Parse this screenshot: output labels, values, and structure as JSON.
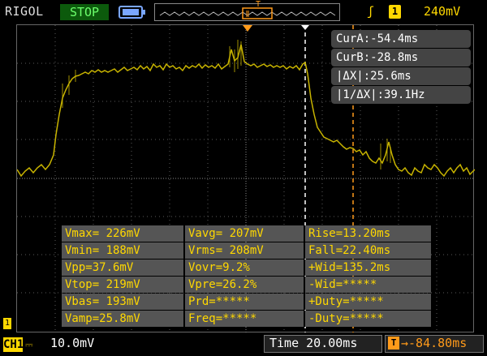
{
  "header": {
    "brand": "RIGOL",
    "run_state": "STOP",
    "trigger": {
      "edge_symbol": "ʃ",
      "source": "1",
      "level": "240mV"
    }
  },
  "cursors": {
    "cur_a": "CurA:-54.4ms",
    "cur_b": "CurB:-28.8ms",
    "delta_x": "|ΔX|:25.6ms",
    "inv_delta_x": "|1/ΔX|:39.1Hz"
  },
  "measurements": [
    [
      "Vmax= 226mV",
      "Vavg= 207mV",
      "Rise=13.20ms"
    ],
    [
      "Vmin= 188mV",
      "Vrms= 208mV",
      "Fall=22.40ms"
    ],
    [
      "Vpp=37.6mV",
      "Vovr=9.2%",
      "+Wid=135.2ms"
    ],
    [
      "Vtop= 219mV",
      "Vpre=26.2%",
      "-Wid=*****"
    ],
    [
      "Vbas= 193mV",
      "Prd=*****",
      "+Duty=*****"
    ],
    [
      "Vamp=25.8mV",
      "Freq=*****",
      "-Duty=*****"
    ]
  ],
  "channel": {
    "label": "CH1",
    "coupling_icon": "dc-coupling-icon",
    "scale": "10.0mV",
    "ground_marker": "1"
  },
  "timebase": "Time 20.00ms",
  "delay": {
    "icon": "T",
    "value": "→-84.80ms"
  },
  "colors": {
    "trace": "#c8b400",
    "trigger": "#ffd800",
    "cursor_a": "#ffffff",
    "cursor_b": "#ff9a1a",
    "run_state_bg": "#0c5a0c"
  }
}
